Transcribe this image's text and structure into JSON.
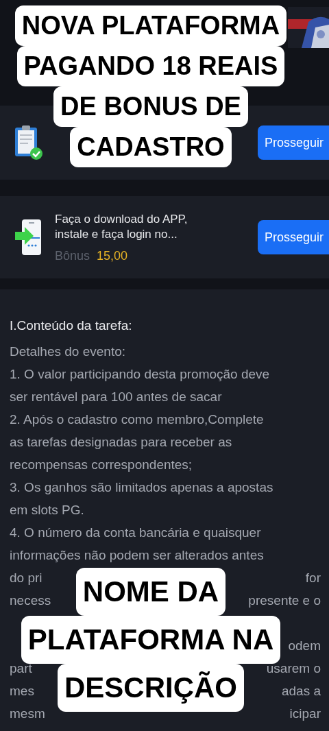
{
  "captions": [
    {
      "lines": [
        "NOVA PLATAFORMA",
        "PAGANDO 18 REAIS",
        "DE BONUS DE",
        "CADASTRO"
      ]
    },
    {
      "lines": [
        "NOME DA",
        "PLATAFORMA NA",
        "DESCRIÇÃO"
      ]
    }
  ],
  "tasks": [
    {
      "kind": "checklist",
      "button": "Prosseguir"
    },
    {
      "kind": "download",
      "title": "Faça o download do APP, instale e faça login no...",
      "bonus_label": "Bônus",
      "bonus_value": "15,00",
      "button": "Prosseguir"
    }
  ],
  "content": {
    "heading": "I.Conteúdo da tarefa:",
    "lines": [
      {
        "kind": "full",
        "text": "Detalhes do evento:"
      },
      {
        "kind": "full",
        "text": "1. O valor participando desta promoção deve"
      },
      {
        "kind": "full",
        "text": "ser rentável para 100 antes de sacar"
      },
      {
        "kind": "full",
        "text": "2. Após o cadastro como membro,Complete"
      },
      {
        "kind": "full",
        "text": "as tarefas designadas para receber as"
      },
      {
        "kind": "full",
        "text": "recompensas correspondentes;"
      },
      {
        "kind": "full",
        "text": "3. Os ganhos são limitados apenas a apostas"
      },
      {
        "kind": "full",
        "text": "em slots PG."
      },
      {
        "kind": "full",
        "text": "4. O número da conta bancária e quaisquer"
      },
      {
        "kind": "full",
        "text": "informações não podem ser alterados antes"
      },
      {
        "kind": "split",
        "left": "do pri",
        "right": "for"
      },
      {
        "kind": "split",
        "left": "necess",
        "right": "presente e o"
      },
      {
        "kind": "hidden"
      },
      {
        "kind": "split",
        "right": "odem"
      },
      {
        "kind": "split",
        "left": "part",
        "right": "usarem o"
      },
      {
        "kind": "split",
        "left": "mes",
        "right": "adas a"
      },
      {
        "kind": "split",
        "left": "mesm",
        "right": "icipar"
      }
    ]
  }
}
